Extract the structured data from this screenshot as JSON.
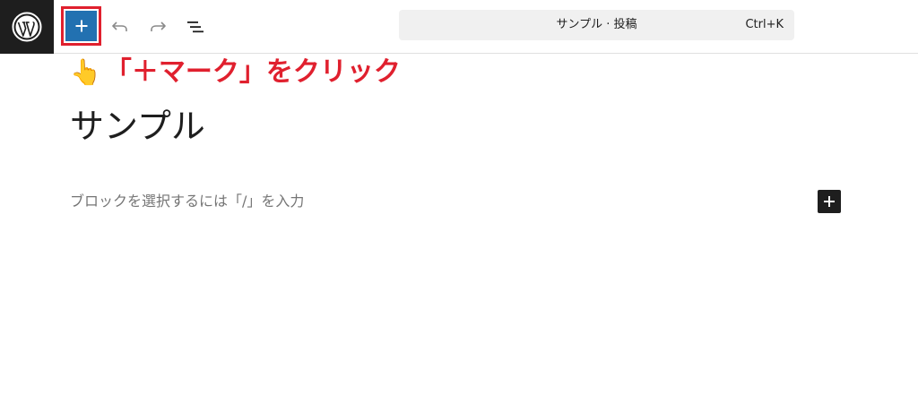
{
  "toolbar": {
    "wp_logo": "wordpress-icon",
    "inserter_icon": "plus-icon",
    "undo_icon": "undo-icon",
    "redo_icon": "redo-icon",
    "list_view_icon": "list-view-icon",
    "inserter_color": "#2271b1",
    "highlight_color": "#e0202e"
  },
  "command_bar": {
    "title": "サンプル · 投稿",
    "shortcut": "Ctrl+K"
  },
  "annotation": {
    "emoji": "👆",
    "text": "「＋マーク」をクリック"
  },
  "editor": {
    "post_title": "サンプル",
    "block_placeholder": "ブロックを選択するには「/」を入力",
    "add_block_icon": "plus-icon"
  }
}
